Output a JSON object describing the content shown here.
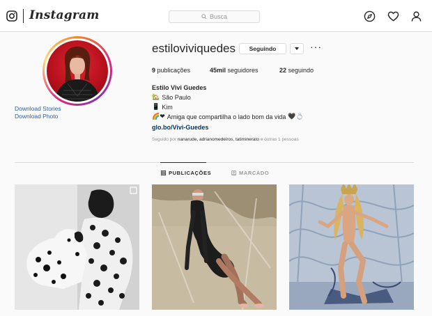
{
  "header": {
    "logo_text": "Instagram",
    "search_placeholder": "Busca",
    "nav_icons": [
      "explore-compass-icon",
      "activity-heart-icon",
      "profile-person-icon"
    ]
  },
  "sidebar_links": {
    "download_stories": "Download Stories",
    "download_photo": "Download Photo"
  },
  "profile": {
    "username": "estiloviviquedes",
    "follow_button": "Seguindo",
    "more_icon": "···",
    "stats": {
      "posts_count": "9",
      "posts_label": "publicações",
      "followers_count": "45mil",
      "followers_label": "seguidores",
      "following_count": "22",
      "following_label": "seguindo"
    },
    "full_name": "Estilo Vivi Guedes",
    "bio": {
      "line1_emoji": "🏡",
      "line1_text": "São Paulo",
      "line2_emoji": "📱",
      "line2_text": "Kim",
      "line3_emoji": "🌈❤",
      "line3_text": "Amiga que compartilha o lado bom da vida",
      "line3_trailing": "🖤💍"
    },
    "link": "glo.bo/Vivi-Guedes",
    "followed_by_prefix": "Seguido por",
    "followed_by_names": "nanarude, adrianomedeiros, tatiminerato",
    "followed_by_suffix": "e outras 1 pessoas"
  },
  "tabs": [
    {
      "label": "PUBLICAÇÕES",
      "active": true
    },
    {
      "label": "MARCADO",
      "active": false
    }
  ],
  "posts": [
    {
      "description": "black-and-white-dalmatian-photo"
    },
    {
      "description": "plastic-wrapped-studio-photo"
    },
    {
      "description": "golden-hair-carnival-photo"
    }
  ],
  "colors": {
    "link_blue": "#003569",
    "download_blue": "#2b5f9a",
    "border": "#dbdbdb",
    "muted_text": "#8e8e8e"
  }
}
